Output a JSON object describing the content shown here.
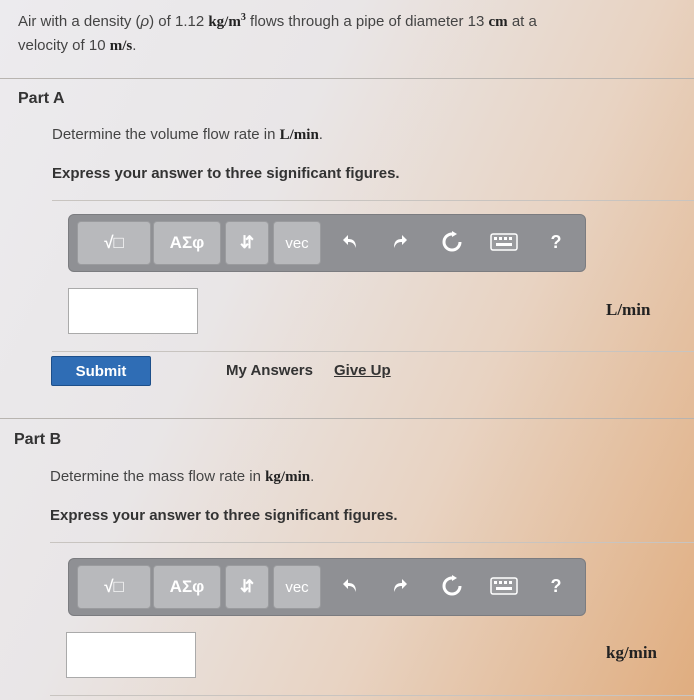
{
  "problem": {
    "line1_pre": "Air with a density (",
    "rho": "ρ",
    "line1_mid": ") of 1.12 ",
    "density_unit": "kg/m",
    "density_exp": "3",
    "line1_post": " flows through a pipe of diameter 13 ",
    "diameter_unit": "cm",
    "line1_end": " at a",
    "line2_pre": "velocity of 10 ",
    "velocity_unit": "m/s",
    "line2_end": "."
  },
  "toolbar": {
    "templates_label": "√□",
    "greek_label": "ΑΣφ",
    "arrows_label": "⇵",
    "vec_label": "vec",
    "undo_icon": "undo-icon",
    "redo_icon": "redo-icon",
    "reset_icon": "reset-icon",
    "keyboard_icon": "keyboard-icon",
    "help_label": "?"
  },
  "part_a": {
    "title": "Part A",
    "question_pre": "Determine the volume flow rate in ",
    "question_unit": "L/min",
    "question_end": ".",
    "instruction": "Express your answer to three significant figures.",
    "answer_value": "",
    "answer_unit": "L/min",
    "submit_label": "Submit",
    "my_answers_label": "My Answers",
    "give_up_label": "Give Up"
  },
  "part_b": {
    "title": "Part B",
    "question_pre": "Determine the mass flow rate in ",
    "question_unit": "kg/min",
    "question_end": ".",
    "instruction": "Express your answer to three significant figures.",
    "answer_value": "",
    "answer_unit": "kg/min"
  }
}
